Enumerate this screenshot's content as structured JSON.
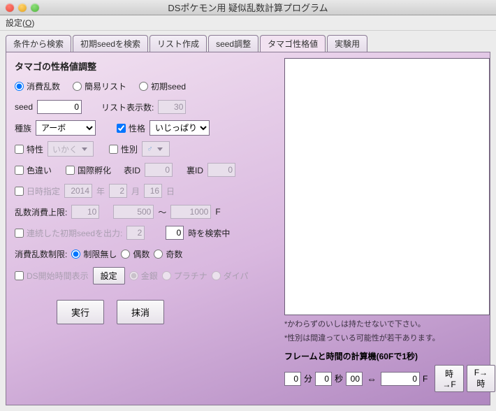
{
  "window": {
    "title": "DSポケモン用 疑似乱数計算プログラム"
  },
  "menu": {
    "settings": "設定(",
    "settings_key": "O",
    "settings_suffix": ")"
  },
  "tabs": [
    "条件から検索",
    "初期seedを検索",
    "リスト作成",
    "seed調整",
    "タマゴ性格値",
    "実験用"
  ],
  "active_tab": 4,
  "h": "タマゴの性格値調整",
  "radios_top": {
    "consume": "消費乱数",
    "simple": "簡易リスト",
    "init": "初期seed"
  },
  "seed_label": "seed",
  "seed_value": "0",
  "list_count_label": "リスト表示数:",
  "list_count_value": "30",
  "species_label": "種族",
  "species_value": "アーボ",
  "species_options": [
    "アーボ"
  ],
  "nature_chk": "性格",
  "nature_value": "いじっぱり",
  "nature_options": [
    "いじっぱり"
  ],
  "ability_chk": "特性",
  "ability_value": "いかく",
  "gender_chk": "性別",
  "gender_value": "♂",
  "shiny_chk": "色違い",
  "intl_chk": "国際孵化",
  "surface_id_label": "表ID",
  "surface_id_value": "0",
  "back_id_label": "裏ID",
  "back_id_value": "0",
  "date_chk": "日時指定",
  "year_value": "2014",
  "year_suf": "年",
  "month_value": "2",
  "month_suf": "月",
  "day_value": "16",
  "day_suf": "日",
  "consume_limit_label": "乱数消費上限:",
  "cl_a": "10",
  "cl_b": "500",
  "cl_tilde": "～",
  "cl_c": "1000",
  "cl_f": "F",
  "cont_seed_chk": "連続した初期seedを出力:",
  "cont_seed_val": "2",
  "cont_seed_h": "0",
  "cont_seed_suf": "時を検索中",
  "consume_restrict_label": "消費乱数制限:",
  "restrict": {
    "none": "制限無し",
    "even": "偶数",
    "odd": "奇数"
  },
  "ds_start_chk": "DS開始時間表示",
  "set_btn": "設定",
  "ver": {
    "gs": "金銀",
    "pt": "プラチナ",
    "dp": "ダイパ"
  },
  "run_btn": "実行",
  "clear_btn": "抹消",
  "note1": "*かわらずのいしは持たせないで下さい。",
  "note2": "*性別は間違っている可能性が若干あります。",
  "calc_head": "フレームと時間の計算機(60Fで1秒)",
  "calc": {
    "min": "0",
    "min_suf": "分",
    "sec": "0",
    "sec_suf": "秒",
    "csec": "00",
    "arrows": "⇔",
    "f": "0",
    "f_suf": "F",
    "to_f": "時→F",
    "to_t": "F→時"
  }
}
